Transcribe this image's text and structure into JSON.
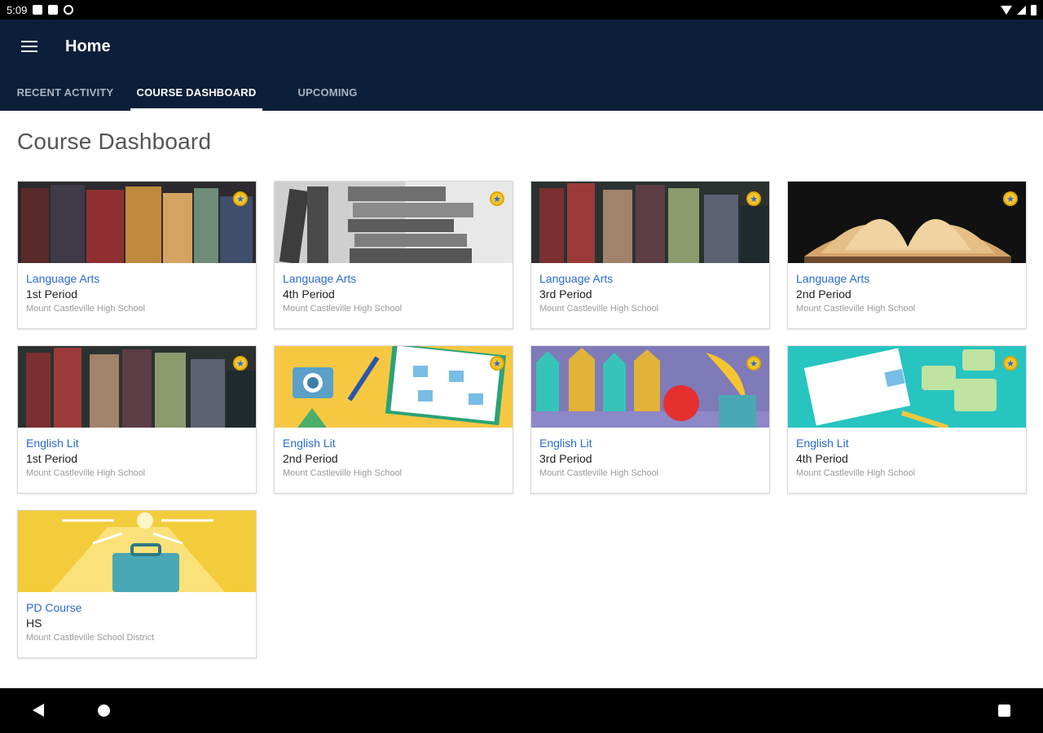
{
  "status_bar": {
    "time": "5:09"
  },
  "app_bar": {
    "title": "Home",
    "tabs": [
      {
        "label": "RECENT ACTIVITY",
        "active": false
      },
      {
        "label": "COURSE DASHBOARD",
        "active": true
      },
      {
        "label": "UPCOMING",
        "active": false
      }
    ]
  },
  "main": {
    "title": "Course Dashboard",
    "courses": [
      {
        "name": "Language Arts",
        "period": "1st Period",
        "school": "Mount Castleville High School",
        "image": "books-spines-1"
      },
      {
        "name": "Language Arts",
        "period": "4th Period",
        "school": "Mount Castleville High School",
        "image": "books-stack-bw"
      },
      {
        "name": "Language Arts",
        "period": "3rd Period",
        "school": "Mount Castleville High School",
        "image": "books-spines-2"
      },
      {
        "name": "Language Arts",
        "period": "2nd Period",
        "school": "Mount Castleville High School",
        "image": "open-book"
      },
      {
        "name": "English Lit",
        "period": "1st Period",
        "school": "Mount Castleville High School",
        "image": "books-spines-2"
      },
      {
        "name": "English Lit",
        "period": "2nd Period",
        "school": "Mount Castleville High School",
        "image": "camera-notebook"
      },
      {
        "name": "English Lit",
        "period": "3rd Period",
        "school": "Mount Castleville High School",
        "image": "houses-apple"
      },
      {
        "name": "English Lit",
        "period": "4th Period",
        "school": "Mount Castleville High School",
        "image": "notebook-chat"
      },
      {
        "name": "PD Course",
        "period": "HS",
        "school": "Mount Castleville School District",
        "image": "briefcase-lightbulb"
      }
    ]
  },
  "colors": {
    "app_bar": "#0c1f3a",
    "link_blue": "#2a6ad1",
    "badge_gold": "#f2c531"
  },
  "icons": {
    "menu": "hamburger-menu-icon",
    "badge": "star-shield-icon",
    "nav_back": "back-triangle-icon",
    "nav_home": "home-circle-icon",
    "nav_recents": "recents-square-icon"
  }
}
